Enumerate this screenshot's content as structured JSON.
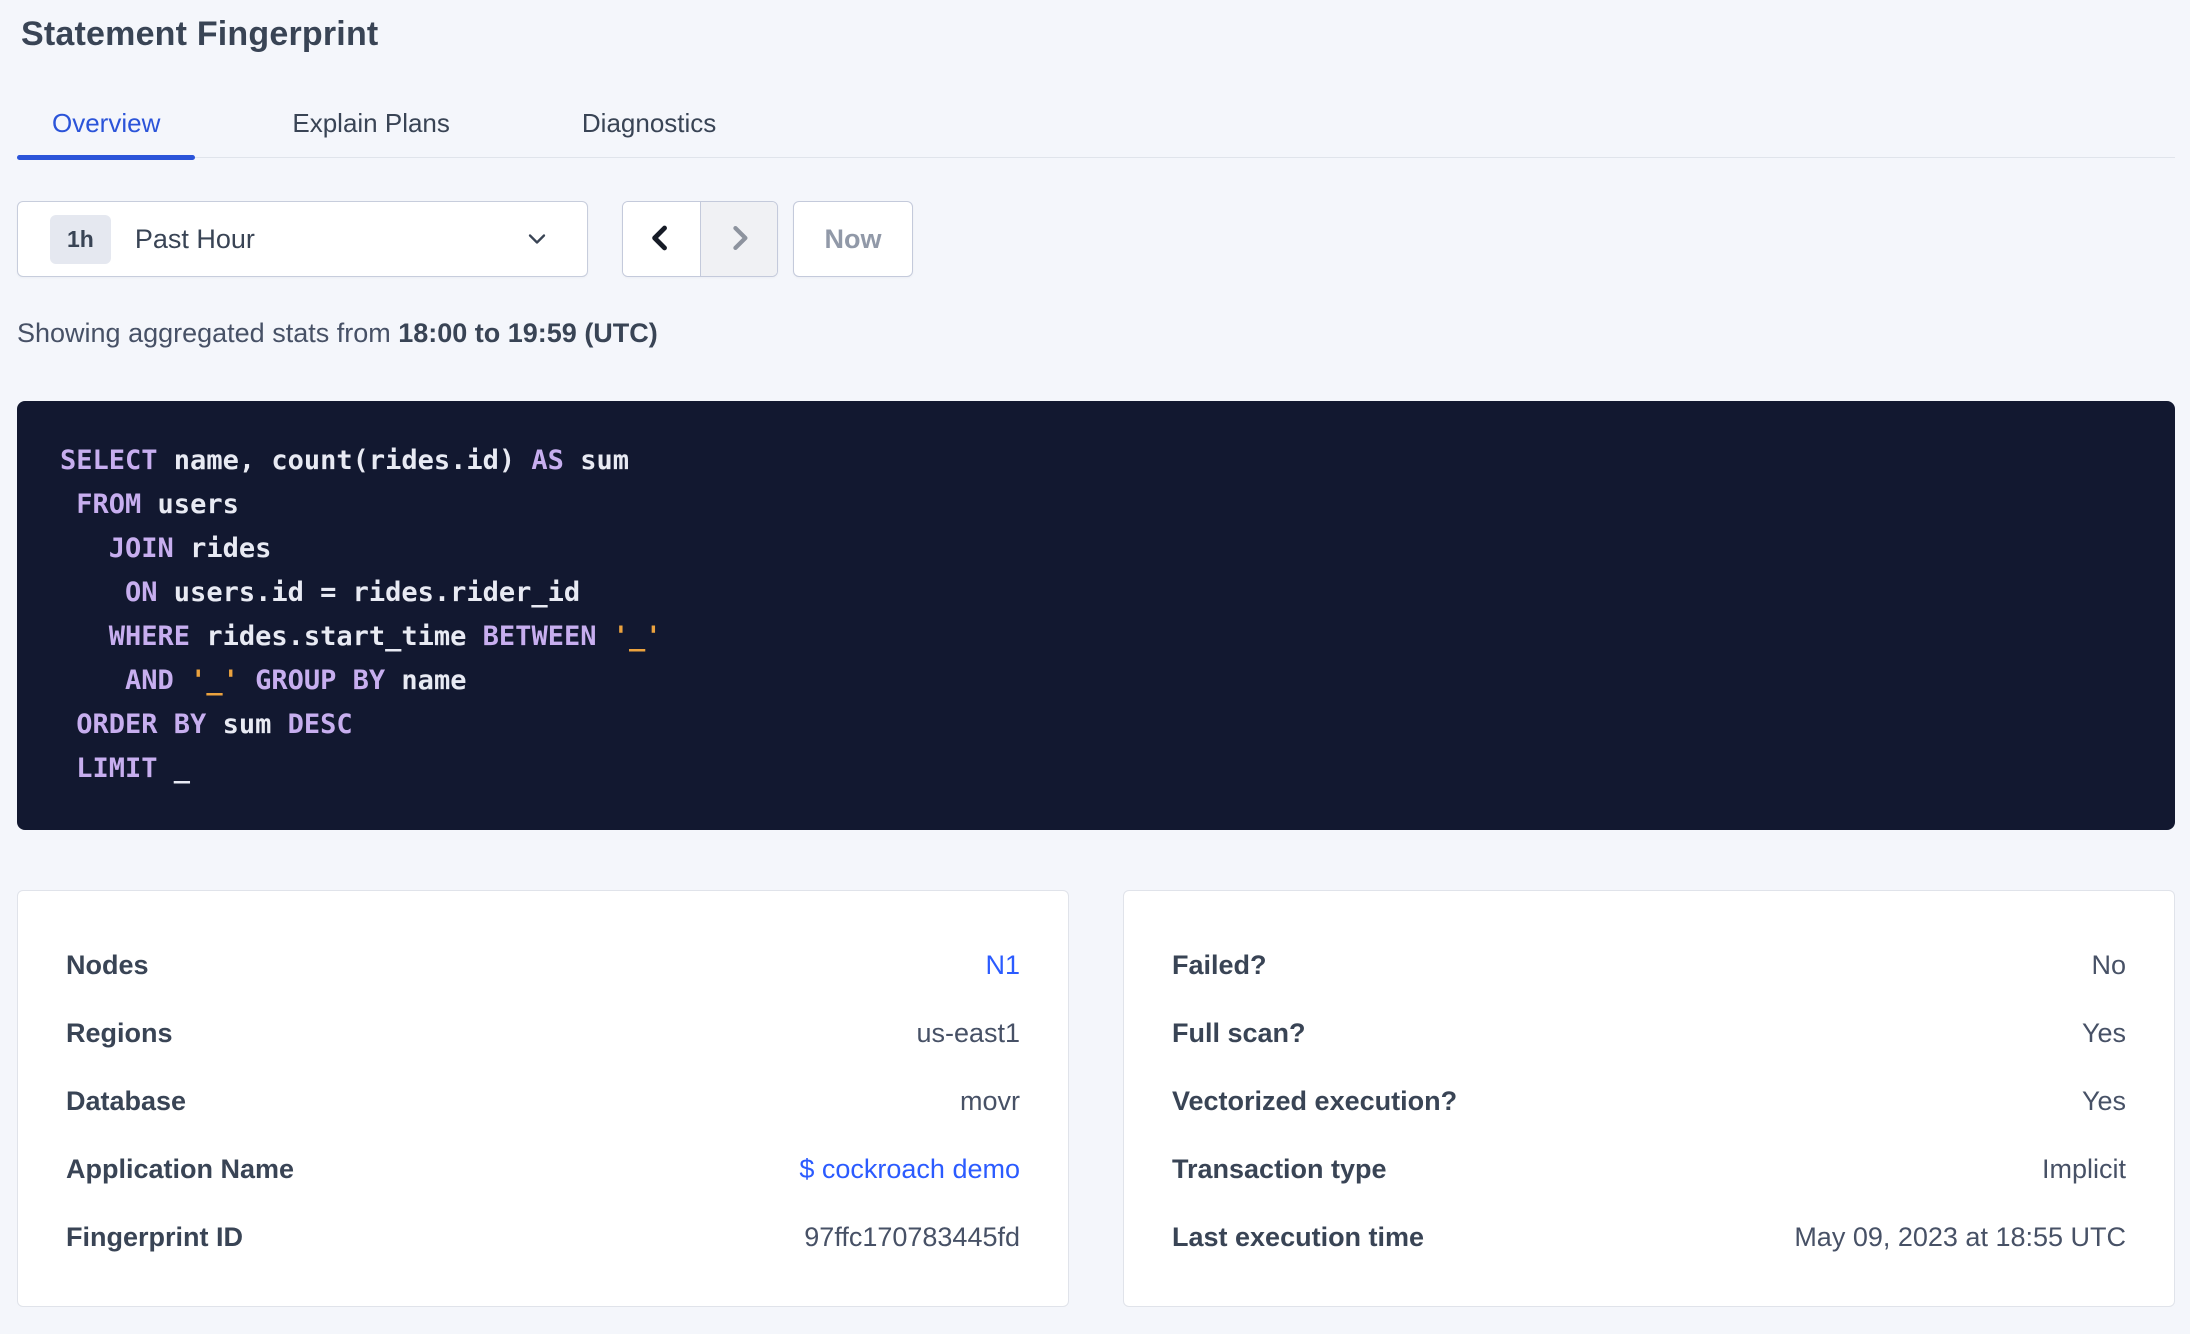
{
  "header": {
    "title": "Statement Fingerprint"
  },
  "tabs": [
    {
      "label": "Overview",
      "active": true
    },
    {
      "label": "Explain Plans",
      "active": false
    },
    {
      "label": "Diagnostics",
      "active": false
    }
  ],
  "time_picker": {
    "badge": "1h",
    "label": "Past Hour"
  },
  "controls": {
    "now_label": "Now"
  },
  "stats": {
    "prefix": "Showing aggregated stats from ",
    "range": "18:00 to 19:59 (UTC)"
  },
  "sql": {
    "lines": [
      [
        [
          "kw",
          "SELECT"
        ],
        [
          "id",
          " name, count(rides.id) "
        ],
        [
          "kw",
          "AS"
        ],
        [
          "id",
          " sum"
        ]
      ],
      [
        [
          "id",
          " "
        ],
        [
          "kw",
          "FROM"
        ],
        [
          "id",
          " users"
        ]
      ],
      [
        [
          "id",
          "   "
        ],
        [
          "kw",
          "JOIN"
        ],
        [
          "id",
          " rides"
        ]
      ],
      [
        [
          "id",
          "    "
        ],
        [
          "kw",
          "ON"
        ],
        [
          "id",
          " users.id = rides.rider_id"
        ]
      ],
      [
        [
          "id",
          "   "
        ],
        [
          "kw",
          "WHERE"
        ],
        [
          "id",
          " rides.start_time "
        ],
        [
          "kw",
          "BETWEEN"
        ],
        [
          "id",
          " "
        ],
        [
          "str",
          "'_'"
        ]
      ],
      [
        [
          "id",
          "    "
        ],
        [
          "kw",
          "AND"
        ],
        [
          "id",
          " "
        ],
        [
          "str",
          "'_'"
        ],
        [
          "id",
          " "
        ],
        [
          "kw",
          "GROUP BY"
        ],
        [
          "id",
          " name"
        ]
      ],
      [
        [
          "id",
          " "
        ],
        [
          "kw",
          "ORDER BY"
        ],
        [
          "id",
          " sum "
        ],
        [
          "kw",
          "DESC"
        ]
      ],
      [
        [
          "id",
          " "
        ],
        [
          "kw",
          "LIMIT"
        ],
        [
          "id",
          " _"
        ]
      ]
    ]
  },
  "cards": {
    "left": {
      "rows": [
        {
          "label": "Nodes",
          "value": "N1",
          "link": true
        },
        {
          "label": "Regions",
          "value": "us-east1",
          "link": false
        },
        {
          "label": "Database",
          "value": "movr",
          "link": false
        },
        {
          "label": "Application Name",
          "value": "$ cockroach demo",
          "link": true
        },
        {
          "label": "Fingerprint ID",
          "value": "97ffc170783445fd",
          "link": false
        }
      ]
    },
    "right": {
      "rows": [
        {
          "label": "Failed?",
          "value": "No",
          "link": false
        },
        {
          "label": "Full scan?",
          "value": "Yes",
          "link": false
        },
        {
          "label": "Vectorized execution?",
          "value": "Yes",
          "link": false
        },
        {
          "label": "Transaction type",
          "value": "Implicit",
          "link": false
        },
        {
          "label": "Last execution time",
          "value": "May 09, 2023 at 18:55 UTC",
          "link": false
        }
      ]
    }
  },
  "colors": {
    "page_background": "#F4F6FB",
    "heading_text": "#394455",
    "tab_active_blue": "#2B54D9",
    "link_blue": "#2B5BFF",
    "sql_background": "#121830",
    "sql_keyword": "#C7AEEF",
    "sql_identifier": "#E8EAF3",
    "sql_literal": "#EBA23E",
    "disabled_text": "#9199A8"
  }
}
